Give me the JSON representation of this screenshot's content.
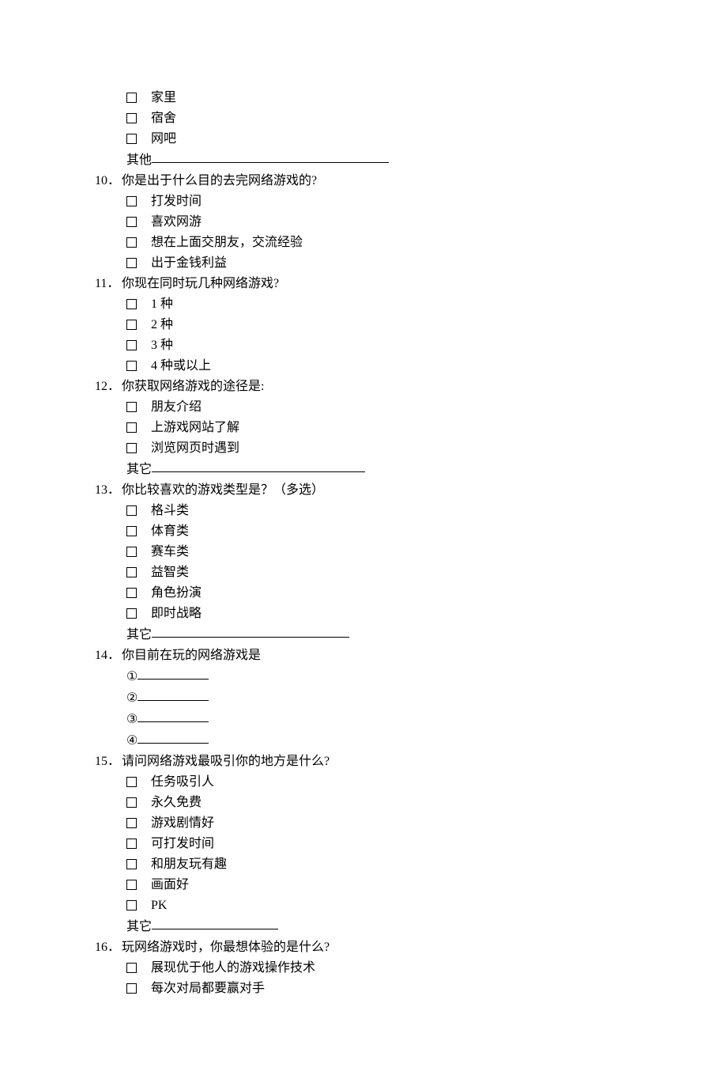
{
  "pre_options": [
    "家里",
    "宿舍",
    "网吧"
  ],
  "pre_other_label": "其他",
  "questions": [
    {
      "num": "10．",
      "text": "你是出于什么目的去完网络游戏的?",
      "options": [
        "打发时间",
        "喜欢网游",
        "想在上面交朋友，交流经验",
        "出于金钱利益"
      ]
    },
    {
      "num": "11．",
      "text": "你现在同时玩几种网络游戏?",
      "options": [
        "1 种",
        "2 种",
        "3 种",
        "4 种或以上"
      ]
    },
    {
      "num": "12．",
      "text": "你获取网络游戏的途径是:",
      "options": [
        "朋友介绍",
        "上游戏网站了解",
        "浏览网页时遇到"
      ],
      "other": {
        "label": "其它",
        "underline_width": 270
      }
    },
    {
      "num": "13．",
      "text": "你比较喜欢的游戏类型是？（多选）",
      "options": [
        "格斗类",
        "体育类",
        "赛车类",
        "益智类",
        "角色扮演",
        "即时战略"
      ],
      "other": {
        "label": "其它",
        "underline_width": 250
      }
    },
    {
      "num": "14．",
      "text": "你目前在玩的网络游戏是",
      "fills": [
        "①",
        "②",
        "③",
        "④"
      ],
      "fill_underline_width": 90
    },
    {
      "num": "15．",
      "text": "请问网络游戏最吸引你的地方是什么?",
      "options": [
        "任务吸引人",
        "永久免费",
        "游戏剧情好",
        "可打发时间",
        "和朋友玩有趣",
        "画面好",
        "PK"
      ],
      "other": {
        "label": "其它",
        "underline_width": 160
      }
    },
    {
      "num": "16．",
      "text": "玩网络游戏时，你最想体验的是什么?",
      "options": [
        "展现优于他人的游戏操作技术",
        "每次对局都要赢对手"
      ]
    }
  ],
  "pre_other_underline_width": 300
}
